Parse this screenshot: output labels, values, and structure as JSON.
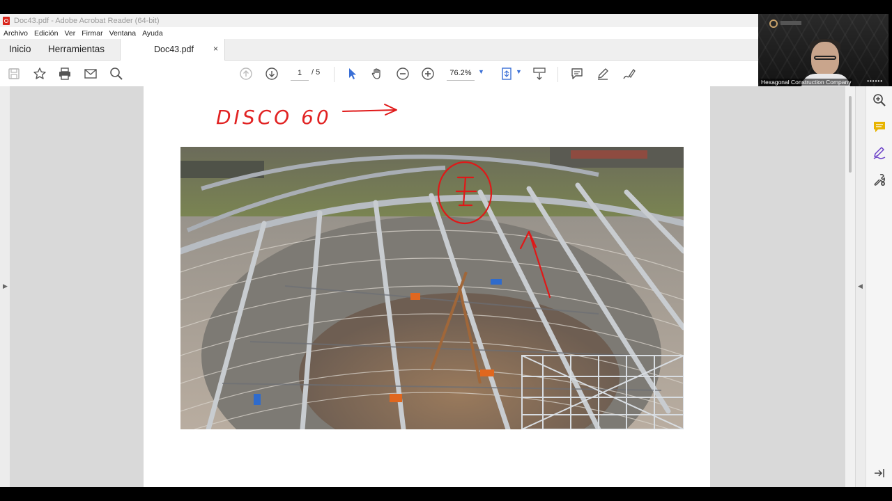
{
  "window": {
    "title": "Doc43.pdf - Adobe Acrobat Reader (64-bit)"
  },
  "menu": [
    "Archivo",
    "Edición",
    "Ver",
    "Firmar",
    "Ventana",
    "Ayuda"
  ],
  "tabs": {
    "home": "Inicio",
    "tools": "Herramientas",
    "document": "Doc43.pdf",
    "close": "×"
  },
  "toolbar": {
    "current_page": "1",
    "total_pages": "/ 5",
    "zoom": "76.2%"
  },
  "webcam": {
    "name": "Hexagonal Construction Company"
  },
  "document": {
    "handwritten_note": "DISCO 60"
  },
  "colors": {
    "accent_blue": "#3a6fd6",
    "annotation_red": "#e01818",
    "comment_yellow": "#e8b400",
    "sign_purple": "#6a3fc8"
  }
}
